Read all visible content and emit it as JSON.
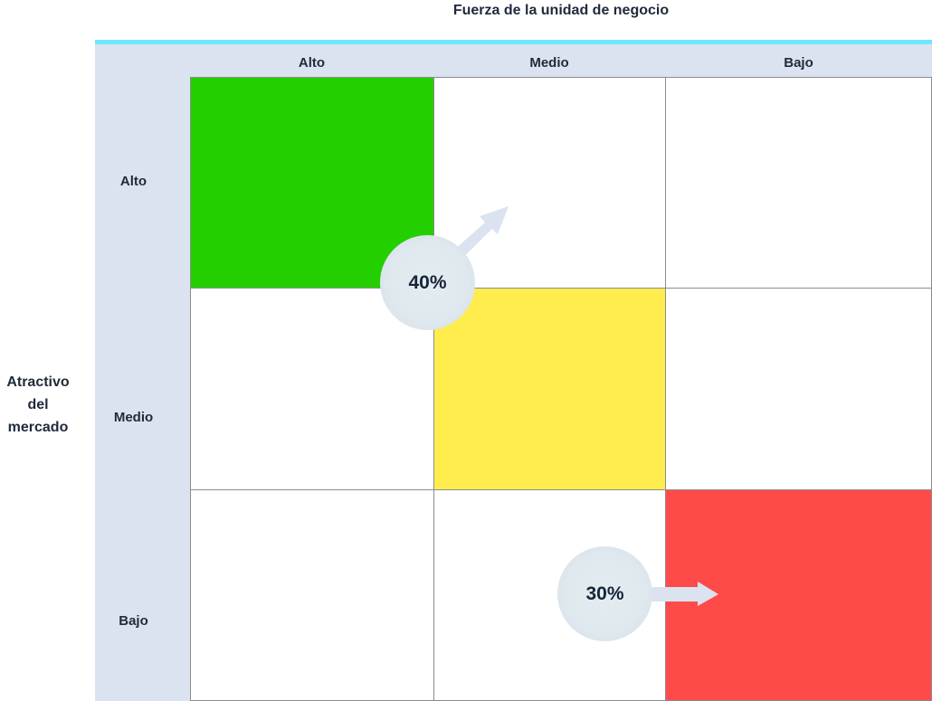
{
  "axis": {
    "x_title": "Fuerza de la unidad de negocio",
    "y_title_lines": [
      "Atractivo",
      "del",
      "mercado"
    ]
  },
  "columns": [
    "Alto",
    "Medio",
    "Bajo"
  ],
  "rows": [
    "Alto",
    "Medio",
    "Bajo"
  ],
  "cells": [
    [
      "#24cf00",
      "#ffffff",
      "#ffffff"
    ],
    [
      "#ffffff",
      "#ffec4d",
      "#ffffff"
    ],
    [
      "#ffffff",
      "#ffffff",
      "#ff4a4a"
    ]
  ],
  "bubbles": [
    {
      "label": "40%"
    },
    {
      "label": "30%"
    }
  ],
  "colors": {
    "accent_rule": "#6ee6ff",
    "band": "#dbe3f1",
    "arrow": "#dbe3f1",
    "text": "#1f2a3a"
  }
}
